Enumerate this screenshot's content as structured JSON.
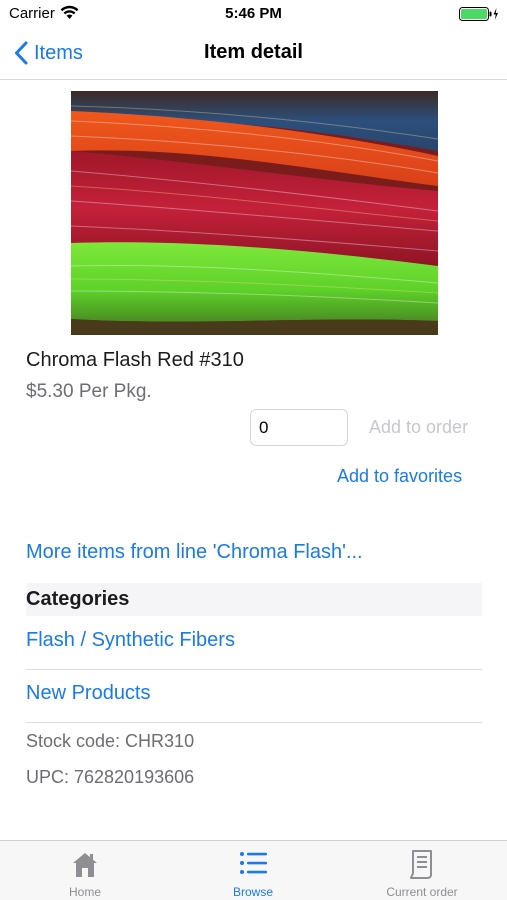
{
  "status_bar": {
    "carrier": "Carrier",
    "time": "5:46 PM",
    "icons": [
      "wifi-icon",
      "battery-icon",
      "charging-icon"
    ]
  },
  "nav": {
    "back_label": "Items",
    "title": "Item detail",
    "back_icon": "chevron-left-icon"
  },
  "product": {
    "image_icon": "product-photo",
    "name": "Chroma Flash Red #310",
    "price": "$5.30 Per Pkg.",
    "quantity": "0",
    "add_to_order_label": "Add to order",
    "add_to_favorites_label": "Add to favorites"
  },
  "more_items_label": "More items from line 'Chroma Flash'...",
  "categories": {
    "title": "Categories",
    "items": [
      {
        "label": "Flash / Synthetic Fibers"
      },
      {
        "label": "New Products"
      }
    ]
  },
  "info": {
    "stock_code": "Stock code: CHR310",
    "upc": "UPC: 762820193606"
  },
  "tab_bar": {
    "items": [
      {
        "label": "Home",
        "icon": "home-icon",
        "active": false
      },
      {
        "label": "Browse",
        "icon": "list-icon",
        "active": true
      },
      {
        "label": "Current order",
        "icon": "receipt-icon",
        "active": false
      }
    ]
  },
  "colors": {
    "accent": "#1a7ae6",
    "disabled_text": "#c7c7cc",
    "secondary_text": "#6d6d72",
    "battery": "#4cd964"
  }
}
